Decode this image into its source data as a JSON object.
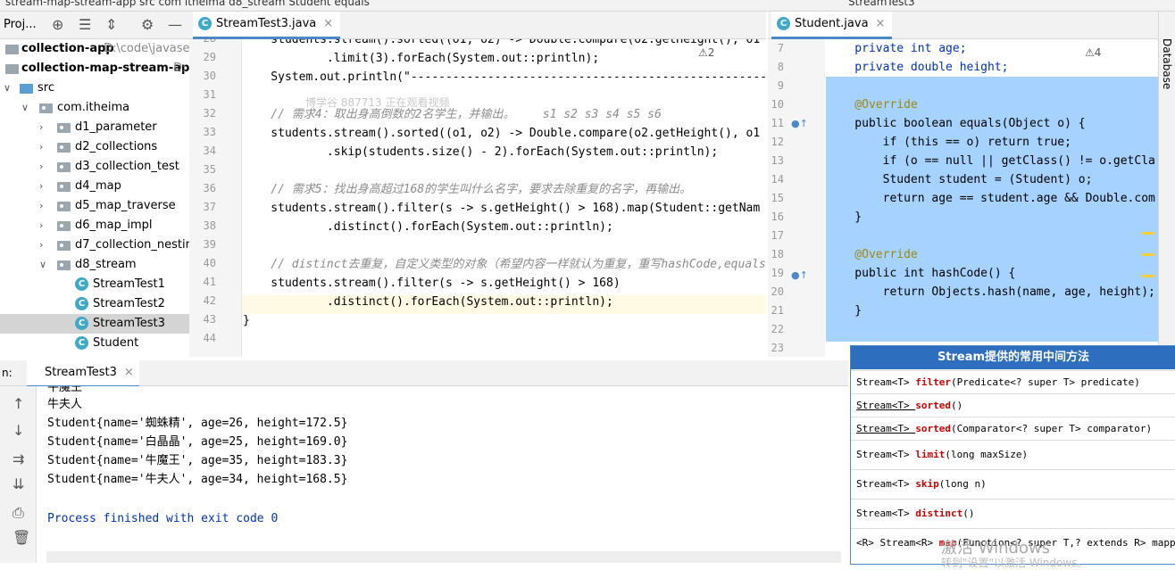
{
  "topbar": {
    "text": "stream-map-stream-app  src  com  itheima  d8_stream  Student  equals",
    "run_config": "StreamTest3"
  },
  "project": {
    "title": "Proj...",
    "items": [
      {
        "label": "collection-app",
        "path": "D:\\code\\javasep"
      },
      {
        "label": "collection-map-stream-app",
        "path": "D:"
      },
      {
        "label": "src"
      },
      {
        "label": "com.itheima"
      },
      {
        "label": "d1_parameter"
      },
      {
        "label": "d2_collections"
      },
      {
        "label": "d3_collection_test"
      },
      {
        "label": "d4_map"
      },
      {
        "label": "d5_map_traverse"
      },
      {
        "label": "d6_map_impl"
      },
      {
        "label": "d7_collection_nesting"
      },
      {
        "label": "d8_stream"
      },
      {
        "label": "StreamTest1"
      },
      {
        "label": "StreamTest2"
      },
      {
        "label": "StreamTest3"
      },
      {
        "label": "Student"
      }
    ]
  },
  "editor1": {
    "tab": "StreamTest3.java",
    "warnings": "⚠2",
    "watermark": "博学谷 887713 正在观看视频",
    "line_numbers": [
      "28",
      "29",
      "30",
      "31",
      "32",
      "33",
      "34",
      "35",
      "36",
      "37",
      "38",
      "39",
      "40",
      "41",
      "42",
      "43",
      "44"
    ],
    "lines": [
      "    students.stream().sorted((o1, o2) -> Double.compare(o2.getHeight(), o1",
      "            .limit(3).forEach(System.out::println);",
      "    System.out.println(\"-----------------------------------------------------\");",
      "",
      "    // 需求4：取出身高倒数的2名学生，并输出。    s1 s2 s3 s4 s5 s6",
      "    students.stream().sorted((o1, o2) -> Double.compare(o2.getHeight(), o1",
      "            .skip(students.size() - 2).forEach(System.out::println);",
      "",
      "    // 需求5：找出身高超过168的学生叫什么名字，要求去除重复的名字，再输出。",
      "    students.stream().filter(s -> s.getHeight() > 168).map(Student::getNam",
      "            .distinct().forEach(System.out::println);",
      "",
      "    // distinct去重复，自定义类型的对象（希望内容一样就认为重复，重写hashCode,equals",
      "    students.stream().filter(s -> s.getHeight() > 168)",
      "            .distinct().forEach(System.out::println);",
      "}",
      ""
    ]
  },
  "editor2": {
    "tab": "Student.java",
    "warnings": "⚠4",
    "line_numbers": [
      "7",
      "8",
      "9",
      "10",
      "11",
      "12",
      "13",
      "14",
      "15",
      "16",
      "17",
      "18",
      "19",
      "20",
      "21",
      "22",
      "23"
    ],
    "lines": [
      "    private int age;",
      "    private double height;",
      "",
      "    @Override",
      "    public boolean equals(Object o) {",
      "        if (this == o) return true;",
      "        if (o == null || getClass() != o.getCla",
      "        Student student = (Student) o;",
      "        return age == student.age && Double.com",
      "    }",
      "",
      "    @Override",
      "    public int hashCode() {",
      "        return Objects.hash(name, age, height);",
      "    }",
      "",
      ""
    ]
  },
  "right_strip": {
    "label": "Database"
  },
  "run": {
    "prefix": "n:",
    "tab": "StreamTest3",
    "output": [
      "牛魔王",
      "牛夫人",
      "Student{name='蜘蛛精', age=26, height=172.5}",
      "Student{name='白晶晶', age=25, height=169.0}",
      "Student{name='牛魔王', age=35, height=183.3}",
      "Student{name='牛夫人', age=34, height=168.5}",
      "",
      "Process finished with exit code 0"
    ]
  },
  "popup": {
    "title": "Stream提供的常用中间方法",
    "rows": [
      {
        "pre": "Stream<T> ",
        "method": "filter",
        "post": "(Predicate<? super T> predicate)"
      },
      {
        "pre": "Stream<T> ",
        "method": "sorted",
        "post": "()"
      },
      {
        "pre": "Stream<T> ",
        "method": "sorted",
        "post": "(Comparator<? super T> comparator)"
      },
      {
        "pre": "Stream<T> ",
        "method": "limit",
        "post": "(long maxSize)"
      },
      {
        "pre": "Stream<T> ",
        "method": "skip",
        "post": "(long n)"
      },
      {
        "pre": "Stream<T> ",
        "method": "distinct",
        "post": "()"
      },
      {
        "pre": "<R> Stream<R> ",
        "method": "map",
        "post": "(Function<? super T,? extends R> mapper)"
      }
    ]
  },
  "windows_watermark": {
    "line1": "激活 Windows",
    "line2": "转到\"设置\"以激活 Windows。"
  }
}
